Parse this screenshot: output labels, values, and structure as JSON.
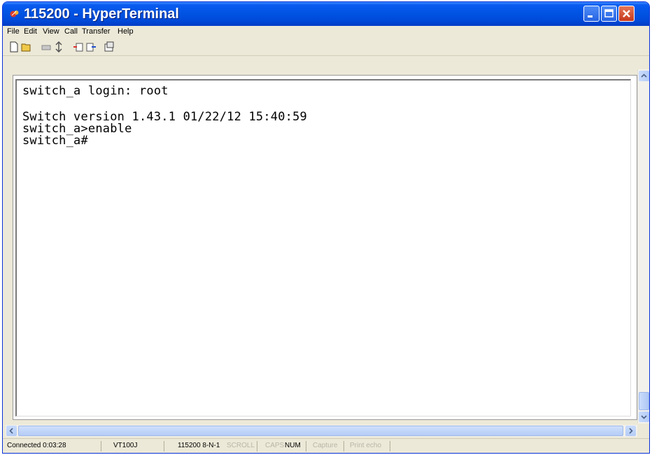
{
  "window": {
    "title": "115200 - HyperTerminal"
  },
  "menu": [
    "File",
    "Edit",
    "View",
    "Call",
    "Transfer",
    "Help"
  ],
  "toolbar": {
    "buttons": [
      "new-icon",
      "open-icon",
      "disconnect-icon",
      "dial-icon",
      "send-icon",
      "receive-icon",
      "properties-icon"
    ]
  },
  "terminal": {
    "lines": [
      "switch_a login: root",
      "",
      "Switch version 1.43.1 01/22/12 15:40:59",
      "switch_a>enable",
      "switch_a#"
    ]
  },
  "status": {
    "connected": "Connected 0:03:28",
    "emulation": "VT100J",
    "settings": "115200 8-N-1",
    "scroll": "SCROLL",
    "caps": "CAPS",
    "num": "NUM",
    "capture": "Capture",
    "print_echo": "Print echo"
  },
  "colors": {
    "titlebar": "#0054e3",
    "terminal_bg": "#ffffff",
    "chrome": "#ece9d8"
  }
}
